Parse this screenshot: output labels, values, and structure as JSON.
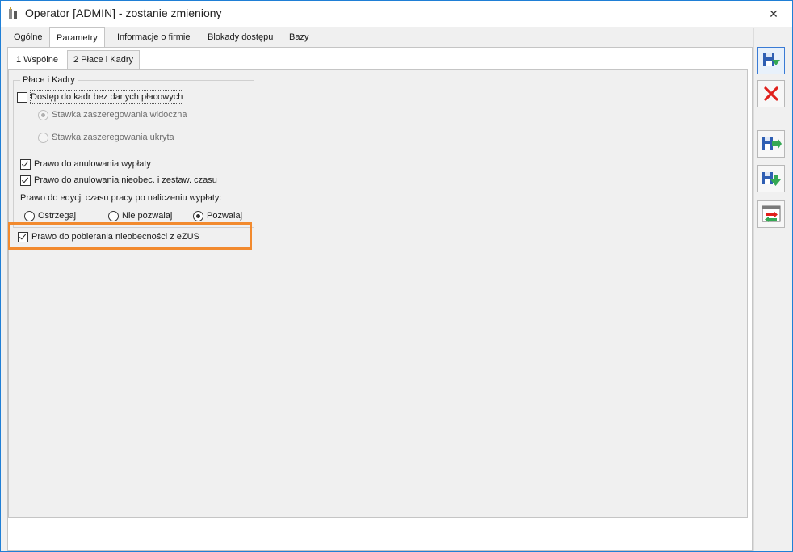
{
  "window": {
    "title": "Operator [ADMIN] - zostanie zmieniony",
    "minimize_glyph": "—",
    "close_glyph": "✕"
  },
  "top_tabs": [
    {
      "label": "Ogólne"
    },
    {
      "label": "Parametry"
    },
    {
      "label": "Informacje o firmie"
    },
    {
      "label": "Blokady dostępu"
    },
    {
      "label": "Bazy"
    }
  ],
  "inner_tabs": [
    {
      "label": "1 Wspólne"
    },
    {
      "label": "2 Płace i Kadry"
    }
  ],
  "group": {
    "title": "Płace i Kadry",
    "access_no_pay": {
      "label": "Dostęp do kadr bez danych płacowych",
      "checked": false
    },
    "rate_visible": {
      "label": "Stawka zaszeregowania widoczna",
      "selected": true,
      "disabled": true
    },
    "rate_hidden": {
      "label": "Stawka zaszeregowania ukryta",
      "selected": false,
      "disabled": true
    },
    "cancel_payout": {
      "label": "Prawo do anulowania wypłaty",
      "checked": true
    },
    "cancel_absence": {
      "label": "Prawo do anulowania nieobec. i zestaw. czasu",
      "checked": true
    },
    "edit_time_label": "Prawo do edycji czasu pracy po naliczeniu wypłaty:",
    "edit_time_options": [
      {
        "label": "Ostrzegaj",
        "selected": false
      },
      {
        "label": "Nie pozwalaj",
        "selected": false
      },
      {
        "label": "Pozwalaj",
        "selected": true
      }
    ],
    "ezus": {
      "label": "Prawo do pobierania nieobecności z eZUS",
      "checked": true
    }
  },
  "side_buttons": [
    {
      "icon": "save-disk-icon"
    },
    {
      "icon": "cancel-x-icon"
    },
    {
      "icon": "save-arrow-icon"
    },
    {
      "icon": "save-down-arrow-icon"
    },
    {
      "icon": "transfer-window-icon"
    }
  ],
  "colors": {
    "highlight": "#f28a2e",
    "window_border": "#1f7fd6",
    "cancel_red": "#e0201b"
  }
}
